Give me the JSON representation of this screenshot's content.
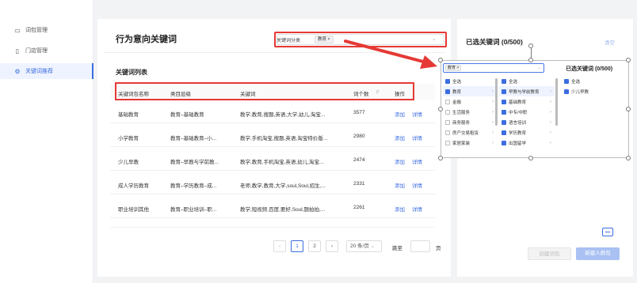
{
  "sidebar": {
    "items": [
      {
        "label": "词包管理",
        "icon": "package-icon",
        "active": false
      },
      {
        "label": "门店管理",
        "icon": "store-icon",
        "active": false
      },
      {
        "label": "关键词推荐",
        "icon": "gear-icon",
        "active": true
      }
    ]
  },
  "page": {
    "title": "行为意向关键词"
  },
  "filter": {
    "label": "关键词分类",
    "tag": "教育"
  },
  "list": {
    "title": "关键词列表",
    "columns": [
      "关键词包名称",
      "类目层级",
      "关键词",
      "词个数",
      "操作"
    ],
    "rows": [
      {
        "name": "基础教育",
        "level": "教育–基础教育",
        "keywords": "教学,教育,搜题,英语,大学,幼儿,淘宝...",
        "count": "3577",
        "add": "添加",
        "detail": "详情"
      },
      {
        "name": "小学教育",
        "level": "教育–基础教育–小...",
        "keywords": "教学,手机淘宝,搜题,英语,淘宝特价版...",
        "count": "2980",
        "add": "添加",
        "detail": "详情"
      },
      {
        "name": "少儿早教",
        "level": "教育–早教与学前教...",
        "keywords": "教学,教育,手机淘宝,英语,幼儿,淘宝...",
        "count": "2474",
        "add": "添加",
        "detail": "详情"
      },
      {
        "name": "成人学历教育",
        "level": "教育–学历教育–成...",
        "keywords": "老师,教学,教育,大学,soul,Soul,招生,...",
        "count": "2331",
        "add": "添加",
        "detail": "详情"
      },
      {
        "name": "职业培训其他",
        "level": "教育–职业培训–职...",
        "keywords": "教学,短视频,百度,要好,Soul,题拍拍,...",
        "count": "2261",
        "add": "添加",
        "detail": "详情"
      }
    ]
  },
  "pagination": {
    "prev": "‹",
    "page1": "1",
    "page2": "2",
    "next": "›",
    "per_page": "20 条/页",
    "goto": "跳至",
    "page_unit": "页"
  },
  "selected_panel": {
    "title": "已选关键词 (0/500)",
    "clear": "清空",
    "create_btn": "创建词包",
    "new_btn": "新建人群包"
  },
  "popup": {
    "search_tag": "教育",
    "title": "已选关键词 (0/500)",
    "col1": [
      {
        "label": "全选",
        "state": "on"
      },
      {
        "label": "教育",
        "state": "on",
        "arrow": true
      },
      {
        "label": "金融",
        "state": "off",
        "arrow": true
      },
      {
        "label": "生活服务",
        "state": "off",
        "arrow": true
      },
      {
        "label": "商务服务",
        "state": "off",
        "arrow": true
      },
      {
        "label": "房产交易租赁",
        "state": "off",
        "arrow": true
      },
      {
        "label": "家居家装",
        "state": "off",
        "arrow": true
      }
    ],
    "col2": [
      {
        "label": "全选",
        "state": "on"
      },
      {
        "label": "早教与学前教育",
        "state": "on",
        "arrow": true
      },
      {
        "label": "基础教育",
        "state": "on",
        "arrow": true
      },
      {
        "label": "中专/中职",
        "state": "on",
        "arrow": true
      },
      {
        "label": "语言培训",
        "state": "on",
        "arrow": true
      },
      {
        "label": "学历教育",
        "state": "on",
        "arrow": true
      },
      {
        "label": "出国留学",
        "state": "on",
        "arrow": true
      }
    ],
    "col3": [
      {
        "label": "全选",
        "state": "on"
      },
      {
        "label": "少儿早教",
        "state": "on"
      }
    ]
  },
  "colors": {
    "accent": "#3b6de0",
    "annotation_red": "#e53935"
  }
}
